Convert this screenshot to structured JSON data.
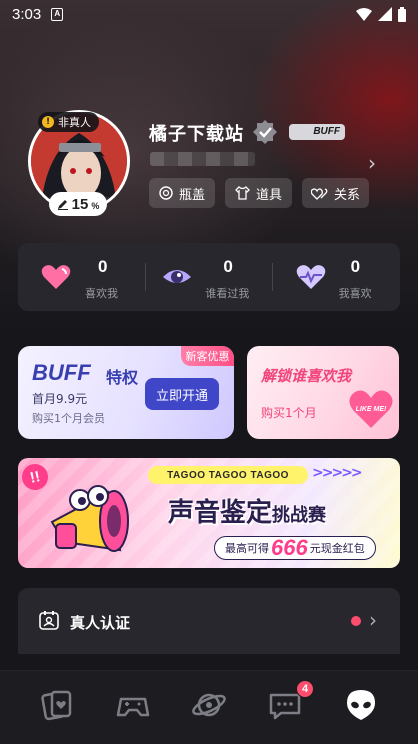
{
  "status_bar": {
    "time": "3:03",
    "notification_glyph": "A"
  },
  "profile": {
    "username": "橘子下载站",
    "fake_badge": "非真人",
    "fake_badge_icon": "!",
    "score": "15",
    "score_unit": "%",
    "tag": "BUFF",
    "chips": [
      {
        "label": "瓶盖",
        "icon": "bottle-cap-icon"
      },
      {
        "label": "道具",
        "icon": "tshirt-icon"
      },
      {
        "label": "关系",
        "icon": "linked-hearts-icon"
      }
    ]
  },
  "stats": [
    {
      "value": "0",
      "label": "喜欢我",
      "icon": "heart-icon",
      "color": "#ff6fa3"
    },
    {
      "value": "0",
      "label": "谁看过我",
      "icon": "eye-icon",
      "color": "#b9a7ff"
    },
    {
      "value": "0",
      "label": "我喜欢",
      "icon": "heartbeat-icon",
      "color": "#d6c9ff"
    }
  ],
  "buff_card": {
    "brand": "BUFF",
    "title": "特权",
    "price": "首月9.9元",
    "subtitle": "购买1个月会员",
    "button": "立即开通",
    "ribbon": "新客优惠"
  },
  "like_card": {
    "title": "解锁谁喜欢我",
    "subtitle": "购买1个月",
    "heart_text": "LIKE ME!"
  },
  "banner": {
    "badge": "!!",
    "strip": "TAGOO TAGOO TAGOO",
    "arrows": ">>>>>",
    "title_main": "声音鉴定",
    "title_tail": "挑战赛",
    "prize_prefix": "最高可得",
    "prize_amount": "666",
    "prize_suffix": "元现金红包"
  },
  "verify_row": {
    "label": "真人认证"
  },
  "bottom_nav": {
    "items": [
      "cards-icon",
      "gamepad-icon",
      "planet-icon",
      "chat-icon",
      "alien-icon"
    ],
    "chat_badge": "4"
  },
  "colors": {
    "accent": "#3f46c8",
    "pink": "#f2457b",
    "badge_red": "#ff4d6d"
  }
}
